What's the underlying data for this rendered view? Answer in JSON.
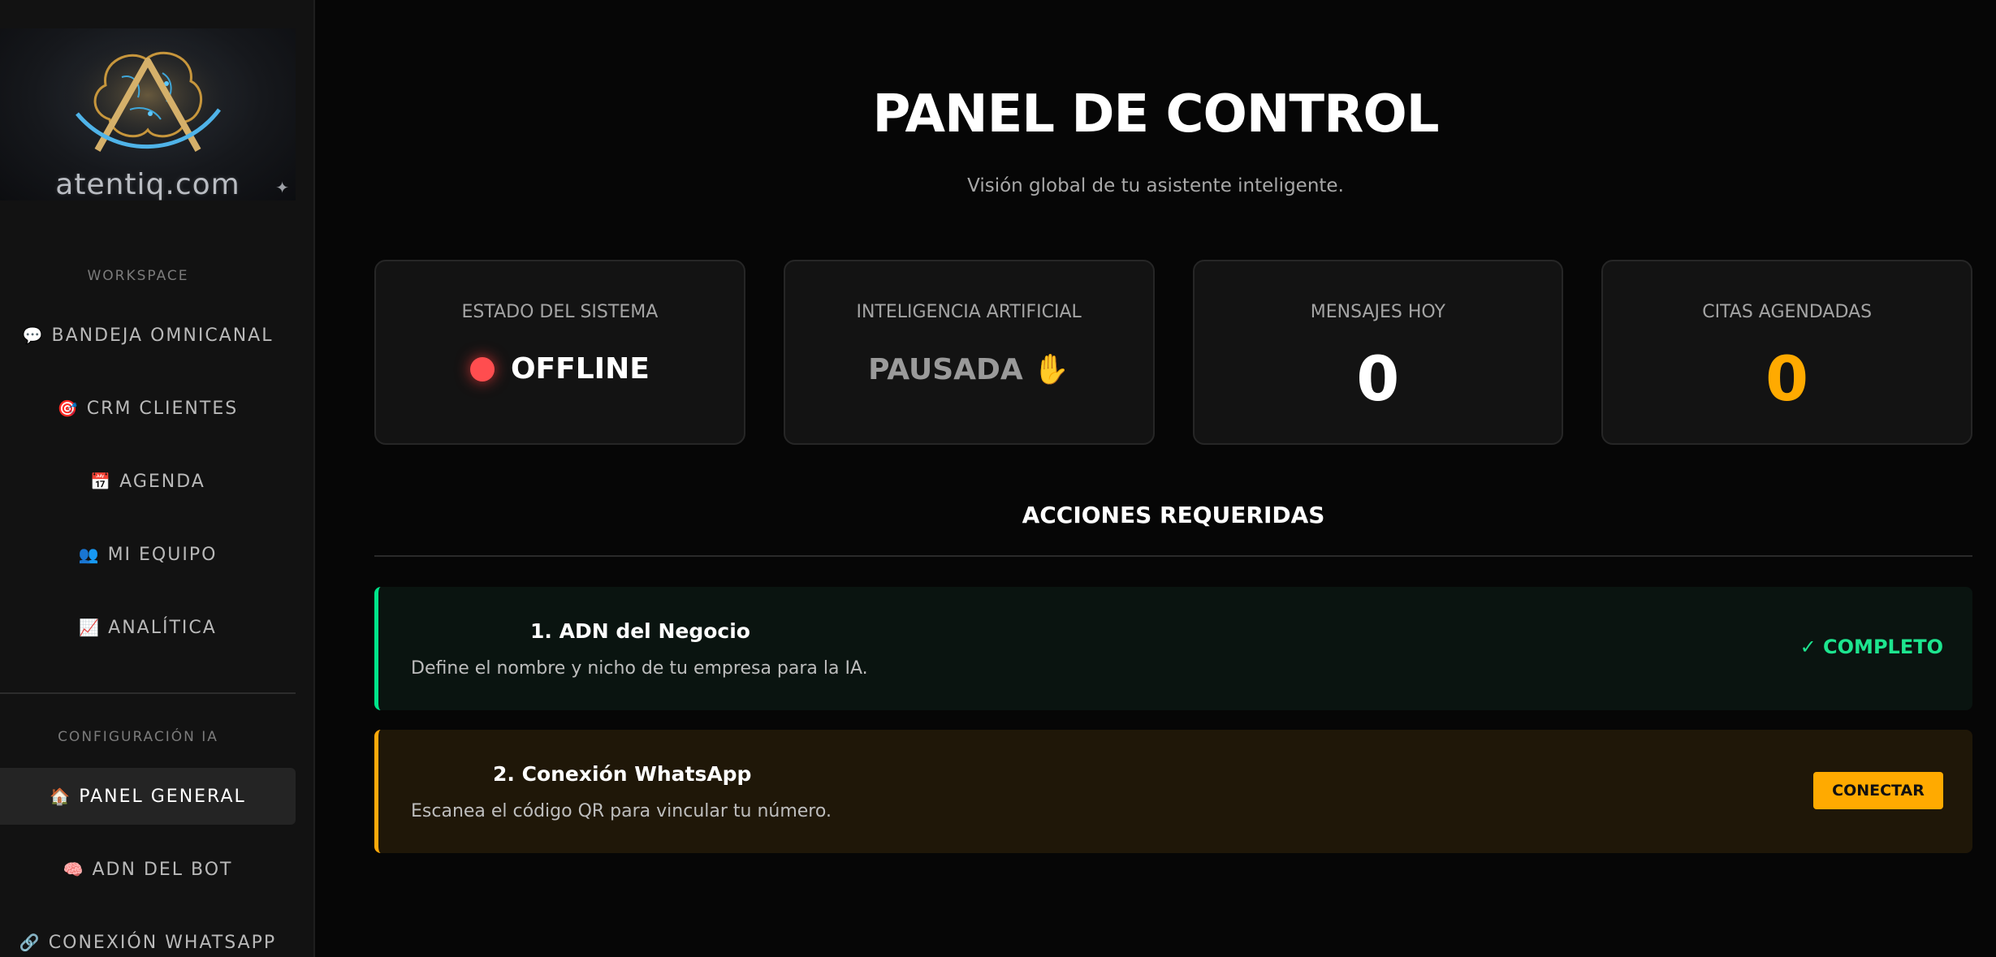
{
  "sidebar": {
    "logo_text": "atentiq.com",
    "workspace_title": "WORKSPACE",
    "workspace_items": [
      {
        "icon": "💬",
        "label": "BANDEJA OMNICANAL"
      },
      {
        "icon": "🎯",
        "label": "CRM CLIENTES"
      },
      {
        "icon": "📅",
        "label": "AGENDA"
      },
      {
        "icon": "👥",
        "label": "MI EQUIPO"
      },
      {
        "icon": "📈",
        "label": "ANALÍTICA"
      }
    ],
    "config_title": "CONFIGURACIÓN IA",
    "config_items": [
      {
        "icon": "🏠",
        "label": "PANEL GENERAL",
        "active": true
      },
      {
        "icon": "🧠",
        "label": "ADN DEL BOT"
      },
      {
        "icon": "🔗",
        "label": "CONEXIÓN WHATSAPP"
      }
    ]
  },
  "main": {
    "title": "PANEL DE CONTROL",
    "subtitle": "Visión global de tu asistente inteligente.",
    "stats": {
      "system": {
        "label": "ESTADO DEL SISTEMA",
        "value": "OFFLINE",
        "color": "#ff4d4f"
      },
      "ai": {
        "label": "INTELIGENCIA ARTIFICIAL",
        "value": "PAUSADA ✋"
      },
      "messages": {
        "label": "MENSAJES HOY",
        "value": "0",
        "color": "#ffffff"
      },
      "appointments": {
        "label": "CITAS AGENDADAS",
        "value": "0",
        "color": "#ffaa00"
      }
    },
    "actions_title": "ACCIONES REQUERIDAS",
    "actions": [
      {
        "title": "1. ADN del Negocio",
        "description": "Define el nombre y nicho de tu empresa para la IA.",
        "status": "✓ COMPLETO"
      },
      {
        "title": "2. Conexión WhatsApp",
        "description": "Escanea el código QR para vincular tu número.",
        "button": "CONECTAR"
      }
    ]
  },
  "colors": {
    "accent_green": "#1de58f",
    "accent_orange": "#ffaa00",
    "status_red": "#ff4d4f"
  }
}
